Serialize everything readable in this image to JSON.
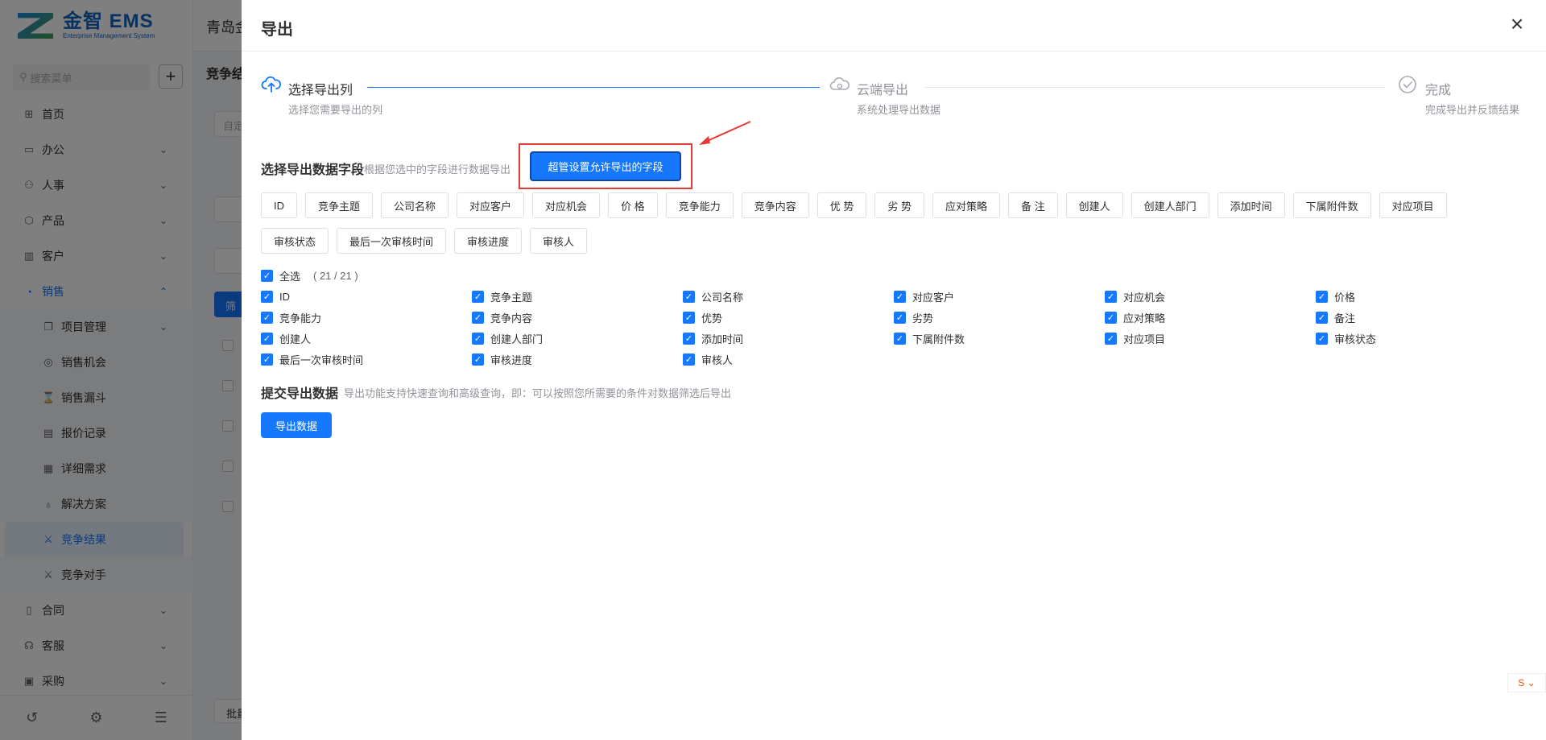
{
  "app": {
    "logo_title": "金智 EMS",
    "logo_subtitle": "Enterprise Management System",
    "company": "青岛金",
    "search_placeholder": "搜索菜单",
    "page_title": "竞争结",
    "filter_btn": "筛",
    "batch_btn": "批量",
    "input_placeholder": "自定"
  },
  "menu": [
    {
      "label": "首页",
      "icon": "home-icon",
      "glyph": "⊞",
      "type": "top"
    },
    {
      "label": "办公",
      "icon": "office-icon",
      "glyph": "▭",
      "type": "top",
      "arrow": "⌄"
    },
    {
      "label": "人事",
      "icon": "people-icon",
      "glyph": "⚇",
      "type": "top",
      "arrow": "⌄"
    },
    {
      "label": "产品",
      "icon": "product-icon",
      "glyph": "⬡",
      "type": "top",
      "arrow": "⌄"
    },
    {
      "label": "客户",
      "icon": "customer-icon",
      "glyph": "▥",
      "type": "top",
      "arrow": "⌄"
    },
    {
      "label": "销售",
      "icon": "sales-icon",
      "glyph": "◔",
      "type": "open",
      "arrow": "⌃"
    },
    {
      "label": "项目管理",
      "icon": "project-icon",
      "glyph": "❐",
      "type": "sub",
      "arrow": "⌄"
    },
    {
      "label": "销售机会",
      "icon": "target-icon",
      "glyph": "◎",
      "type": "sub"
    },
    {
      "label": "销售漏斗",
      "icon": "hourglass-icon",
      "glyph": "⌛",
      "type": "sub"
    },
    {
      "label": "报价记录",
      "icon": "quote-icon",
      "glyph": "▤",
      "type": "sub"
    },
    {
      "label": "详细需求",
      "icon": "doc-icon",
      "glyph": "▦",
      "type": "sub"
    },
    {
      "label": "解决方案",
      "icon": "bulb-icon",
      "glyph": "♁",
      "type": "sub"
    },
    {
      "label": "竞争结果",
      "icon": "compete-icon",
      "glyph": "⚔",
      "type": "active"
    },
    {
      "label": "竞争对手",
      "icon": "rival-icon",
      "glyph": "⚔",
      "type": "sub"
    },
    {
      "label": "合同",
      "icon": "contract-icon",
      "glyph": "▯",
      "type": "top",
      "arrow": "⌄"
    },
    {
      "label": "客服",
      "icon": "service-icon",
      "glyph": "☊",
      "type": "top",
      "arrow": "⌄"
    },
    {
      "label": "采购",
      "icon": "purchase-icon",
      "glyph": "▣",
      "type": "top",
      "arrow": "⌄"
    }
  ],
  "drawer": {
    "title": "导出",
    "close": "×",
    "steps": [
      {
        "title": "选择导出列",
        "desc": "选择您需要导出的列",
        "status": "active"
      },
      {
        "title": "云端导出",
        "desc": "系统处理导出数据",
        "status": "inactive"
      },
      {
        "title": "完成",
        "desc": "完成导出并反馈结果",
        "status": "inactive"
      }
    ],
    "select_section_title": "选择导出数据字段",
    "select_section_hint": "根据您选中的字段进行数据导出",
    "super_btn": "超管设置允许导出的字段",
    "field_tags_row1": [
      "ID",
      "竞争主题",
      "公司名称",
      "对应客户",
      "对应机会",
      "价 格",
      "竞争能力",
      "竞争内容",
      "优 势",
      "劣 势",
      "应对策略",
      "备 注",
      "创建人",
      "创建人部门",
      "添加时间",
      "下属附件数",
      "对应项目"
    ],
    "field_tags_row2": [
      "审核状态",
      "最后一次审核时间",
      "审核进度",
      "审核人"
    ],
    "check_all_label": "全选",
    "check_all_count": "( 21 / 21 )",
    "checkboxes": [
      "ID",
      "竞争主题",
      "公司名称",
      "对应客户",
      "对应机会",
      "价格",
      "竞争能力",
      "竞争内容",
      "优势",
      "劣势",
      "应对策略",
      "备注",
      "创建人",
      "创建人部门",
      "添加时间",
      "下属附件数",
      "对应项目",
      "审核状态",
      "最后一次审核时间",
      "审核进度",
      "审核人"
    ],
    "submit_section_title": "提交导出数据",
    "submit_section_hint": "导出功能支持快速查询和高级查询，即：可以按照您所需要的条件对数据筛选后导出",
    "export_btn": "导出数据"
  },
  "colors": {
    "primary": "#1677ff",
    "highlight": "#e53935"
  }
}
